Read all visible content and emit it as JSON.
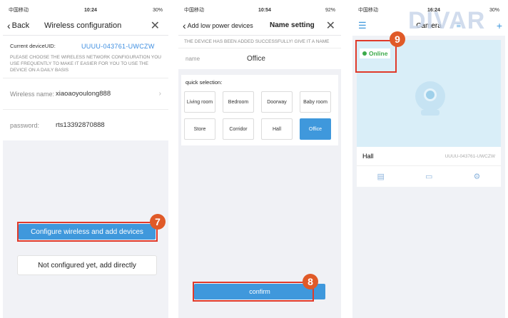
{
  "phone1": {
    "status": {
      "carrier": "中国移动",
      "time": "10:24",
      "battery": "30%"
    },
    "nav": {
      "back_label": "Back",
      "title": "Wireless configuration"
    },
    "uid_label": "Current deviceUID:",
    "uid_value": "UUUU-043761-UWCZW",
    "hint": "PLEASE CHOOSE THE WIRELESS NETWORK CONFIGURATION YOU USE FREQUENTLY TO MAKE IT EASIER FOR YOU TO USE THE DEVICE ON A DAILY BASIS",
    "wireless_label": "Wireless name:",
    "wireless_value": "xiaoaoyoulong888",
    "password_label": "password:",
    "password_value": "rts13392870888",
    "configure_button": "Configure wireless and add devices",
    "direct_button": "Not configured yet, add directly",
    "step_badge": "7"
  },
  "phone2": {
    "status": {
      "carrier": "中国移动",
      "time": "10:54",
      "battery": "92%"
    },
    "nav": {
      "back_label": "Add low power devices",
      "title": "Name setting"
    },
    "success_text": "THE DEVICE HAS BEEN ADDED SUCCESSFULLY! GIVE IT A NAME",
    "name_label": "name",
    "name_value": "Office",
    "quick_title": "quick selection:",
    "chips": [
      "Living room",
      "Bedroom",
      "Doorway",
      "Baby room",
      "Store",
      "Corridor",
      "Hall",
      "Office"
    ],
    "selected_chip": "Office",
    "confirm_button": "confirm",
    "step_badge": "8"
  },
  "phone3": {
    "status": {
      "carrier": "中国移动",
      "time": "16:24",
      "battery": "30%"
    },
    "nav": {
      "title": "Camera"
    },
    "online_label": "Online",
    "device_name": "Hall",
    "device_uid": "UUUU-043761-UWCZW",
    "step_badge": "9"
  },
  "watermark": "DIVAR",
  "colors": {
    "accent": "#3f98dc",
    "highlight": "#e03a2a",
    "badge": "#e05a28",
    "online": "#3caa4a"
  }
}
